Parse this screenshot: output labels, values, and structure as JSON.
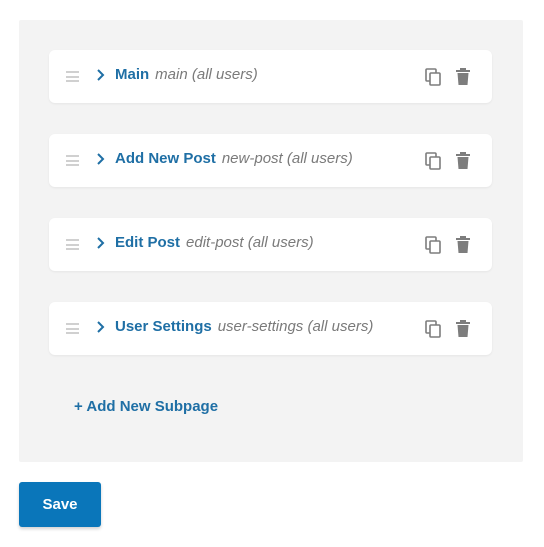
{
  "subpages": [
    {
      "title": "Main",
      "slug": "main (all users)"
    },
    {
      "title": "Add New Post",
      "slug": "new-post (all users)"
    },
    {
      "title": "Edit Post",
      "slug": "edit-post (all users)"
    },
    {
      "title": "User Settings",
      "slug": "user-settings (all users)"
    }
  ],
  "add_subpage_label": "+ Add New Subpage",
  "save_label": "Save",
  "colors": {
    "accent": "#1f6fa5",
    "button": "#0a76ba",
    "panel": "#f3f3f3",
    "muted": "#7a7a7a",
    "icon": "#7d7d7d"
  },
  "icons": {
    "drag": "drag-handle-icon",
    "expand": "chevron-right-icon",
    "copy": "copy-icon",
    "delete": "trash-icon"
  }
}
